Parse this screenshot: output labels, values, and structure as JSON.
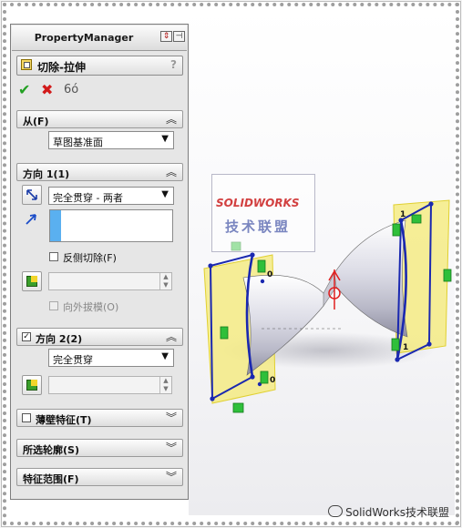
{
  "panel": {
    "title": "PropertyManager",
    "feature_title": "切除-拉伸",
    "help": "?",
    "pin_icon": "pin-icon",
    "actions": {
      "ok": "✔",
      "cancel": "✖",
      "preview": "6ó"
    }
  },
  "sections": {
    "from": {
      "label": "从(F)",
      "value": "草图基准面"
    },
    "direction1": {
      "label": "方向 1(1)",
      "end_condition": "完全贯穿 - 两者",
      "flip_side": "反侧切除(F)",
      "draft_outward": "向外拔模(O)"
    },
    "direction2": {
      "label": "方向 2(2)",
      "checked": "✓",
      "end_condition": "完全贯穿"
    },
    "thin_feature": {
      "label": "薄壁特征(T)"
    },
    "selected_contours": {
      "label": "所选轮廓(S)"
    },
    "feature_scope": {
      "label": "特征范围(F)"
    }
  },
  "chevrons": {
    "up": "︽",
    "down": "︾",
    "dropdown": "▼"
  },
  "viewport": {
    "dimension_labels": [
      "0",
      "0",
      "1",
      "1"
    ]
  },
  "watermarks": {
    "logo_brand": "SOLIDWORKS",
    "logo_cn": "技术联盟",
    "footer": "SolidWorks技术联盟"
  },
  "colors": {
    "sketch_blue": "#1a28b0",
    "face_yellow": "#f2e650",
    "handle_green": "#2fbf3a",
    "preview_red": "#e02020",
    "selection_blue": "#5ab0f0"
  }
}
